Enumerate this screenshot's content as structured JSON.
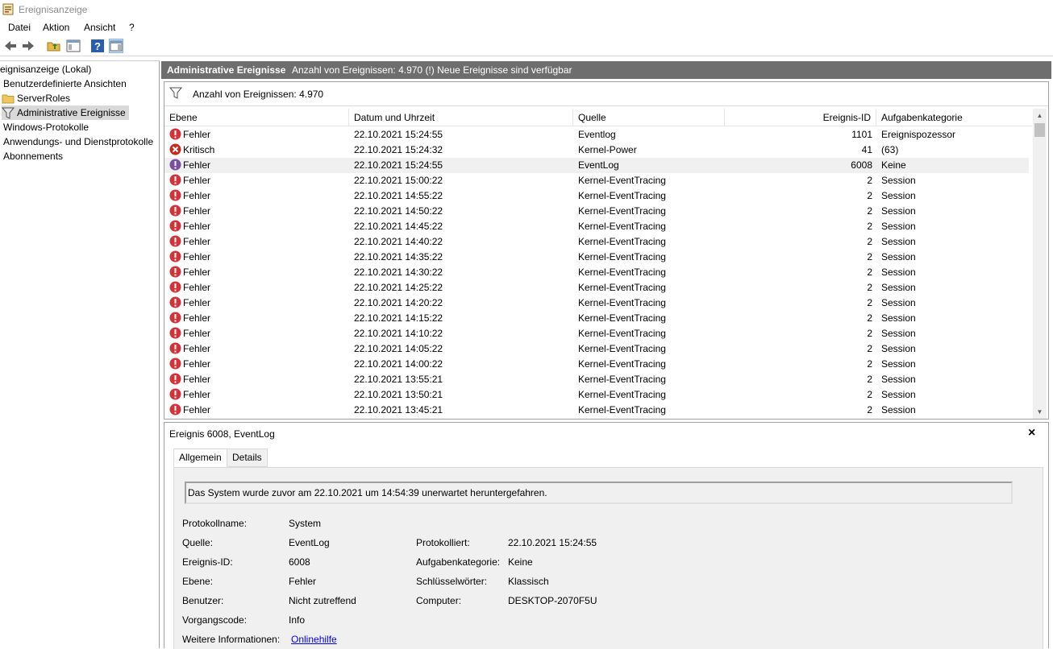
{
  "window": {
    "title": "Ereignisanzeige"
  },
  "menu": [
    "Datei",
    "Aktion",
    "Ansicht",
    "?"
  ],
  "tree": {
    "root": "eignisanzeige (Lokal)",
    "custom_views": "Benutzerdefinierte Ansichten",
    "server_roles": "ServerRoles",
    "admin_events": "Administrative Ereignisse",
    "windows_logs": "Windows-Protokolle",
    "app_service_logs": "Anwendungs- und Dienstprotokolle",
    "subscriptions": "Abonnements"
  },
  "header": {
    "title": "Administrative Ereignisse",
    "info": "Anzahl von Ereignissen: 4.970 (!) Neue Ereignisse sind verfügbar"
  },
  "filter": {
    "label": "Anzahl von Ereignissen: 4.970"
  },
  "columns": [
    "Ebene",
    "Datum und Uhrzeit",
    "Quelle",
    "Ereignis-ID",
    "Aufgabenkategorie"
  ],
  "rows": [
    {
      "level": "Fehler",
      "icon": "error",
      "datetime": "22.10.2021 15:24:55",
      "source": "Eventlog",
      "id": "1101",
      "category": "Ereignispozessor"
    },
    {
      "level": "Kritisch",
      "icon": "critical",
      "datetime": "22.10.2021 15:24:32",
      "source": "Kernel-Power",
      "id": "41",
      "category": "(63)"
    },
    {
      "level": "Fehler",
      "icon": "error-selected",
      "datetime": "22.10.2021 15:24:55",
      "source": "EventLog",
      "id": "6008",
      "category": "Keine"
    },
    {
      "level": "Fehler",
      "icon": "error",
      "datetime": "22.10.2021 15:00:22",
      "source": "Kernel-EventTracing",
      "id": "2",
      "category": "Session"
    },
    {
      "level": "Fehler",
      "icon": "error",
      "datetime": "22.10.2021 14:55:22",
      "source": "Kernel-EventTracing",
      "id": "2",
      "category": "Session"
    },
    {
      "level": "Fehler",
      "icon": "error",
      "datetime": "22.10.2021 14:50:22",
      "source": "Kernel-EventTracing",
      "id": "2",
      "category": "Session"
    },
    {
      "level": "Fehler",
      "icon": "error",
      "datetime": "22.10.2021 14:45:22",
      "source": "Kernel-EventTracing",
      "id": "2",
      "category": "Session"
    },
    {
      "level": "Fehler",
      "icon": "error",
      "datetime": "22.10.2021 14:40:22",
      "source": "Kernel-EventTracing",
      "id": "2",
      "category": "Session"
    },
    {
      "level": "Fehler",
      "icon": "error",
      "datetime": "22.10.2021 14:35:22",
      "source": "Kernel-EventTracing",
      "id": "2",
      "category": "Session"
    },
    {
      "level": "Fehler",
      "icon": "error",
      "datetime": "22.10.2021 14:30:22",
      "source": "Kernel-EventTracing",
      "id": "2",
      "category": "Session"
    },
    {
      "level": "Fehler",
      "icon": "error",
      "datetime": "22.10.2021 14:25:22",
      "source": "Kernel-EventTracing",
      "id": "2",
      "category": "Session"
    },
    {
      "level": "Fehler",
      "icon": "error",
      "datetime": "22.10.2021 14:20:22",
      "source": "Kernel-EventTracing",
      "id": "2",
      "category": "Session"
    },
    {
      "level": "Fehler",
      "icon": "error",
      "datetime": "22.10.2021 14:15:22",
      "source": "Kernel-EventTracing",
      "id": "2",
      "category": "Session"
    },
    {
      "level": "Fehler",
      "icon": "error",
      "datetime": "22.10.2021 14:10:22",
      "source": "Kernel-EventTracing",
      "id": "2",
      "category": "Session"
    },
    {
      "level": "Fehler",
      "icon": "error",
      "datetime": "22.10.2021 14:05:22",
      "source": "Kernel-EventTracing",
      "id": "2",
      "category": "Session"
    },
    {
      "level": "Fehler",
      "icon": "error",
      "datetime": "22.10.2021 14:00:22",
      "source": "Kernel-EventTracing",
      "id": "2",
      "category": "Session"
    },
    {
      "level": "Fehler",
      "icon": "error",
      "datetime": "22.10.2021 13:55:21",
      "source": "Kernel-EventTracing",
      "id": "2",
      "category": "Session"
    },
    {
      "level": "Fehler",
      "icon": "error",
      "datetime": "22.10.2021 13:50:21",
      "source": "Kernel-EventTracing",
      "id": "2",
      "category": "Session"
    },
    {
      "level": "Fehler",
      "icon": "error",
      "datetime": "22.10.2021 13:45:21",
      "source": "Kernel-EventTracing",
      "id": "2",
      "category": "Session"
    }
  ],
  "selected_row": 2,
  "detail": {
    "title": "Ereignis 6008, EventLog",
    "close": "×",
    "tabs": [
      "Allgemein",
      "Details"
    ],
    "description": "Das System wurde zuvor am 22.10.2021 um 14:54:39 unerwartet heruntergefahren.",
    "left_labels": [
      "Protokollname:",
      "Quelle:",
      "Ereignis-ID:",
      "Ebene:",
      "Benutzer:",
      "Vorgangscode:",
      "Weitere Informationen:"
    ],
    "left_values": [
      "System",
      "EventLog",
      "6008",
      "Fehler",
      "Nicht zutreffend",
      "Info"
    ],
    "more_info_link": "Onlinehilfe",
    "right_labels": [
      "Protokolliert:",
      "Aufgabenkategorie:",
      "Schlüsselwörter:",
      "Computer:"
    ],
    "right_values": [
      "22.10.2021 15:24:55",
      "Keine",
      "Klassisch",
      "DESKTOP-2070F5U"
    ]
  },
  "colors": {
    "header_bg": "#6e6e6e",
    "error_red": "#d13438",
    "critical_red": "#c42b1c",
    "selected_row": "#f0f0f0",
    "link": "#0000ee"
  }
}
